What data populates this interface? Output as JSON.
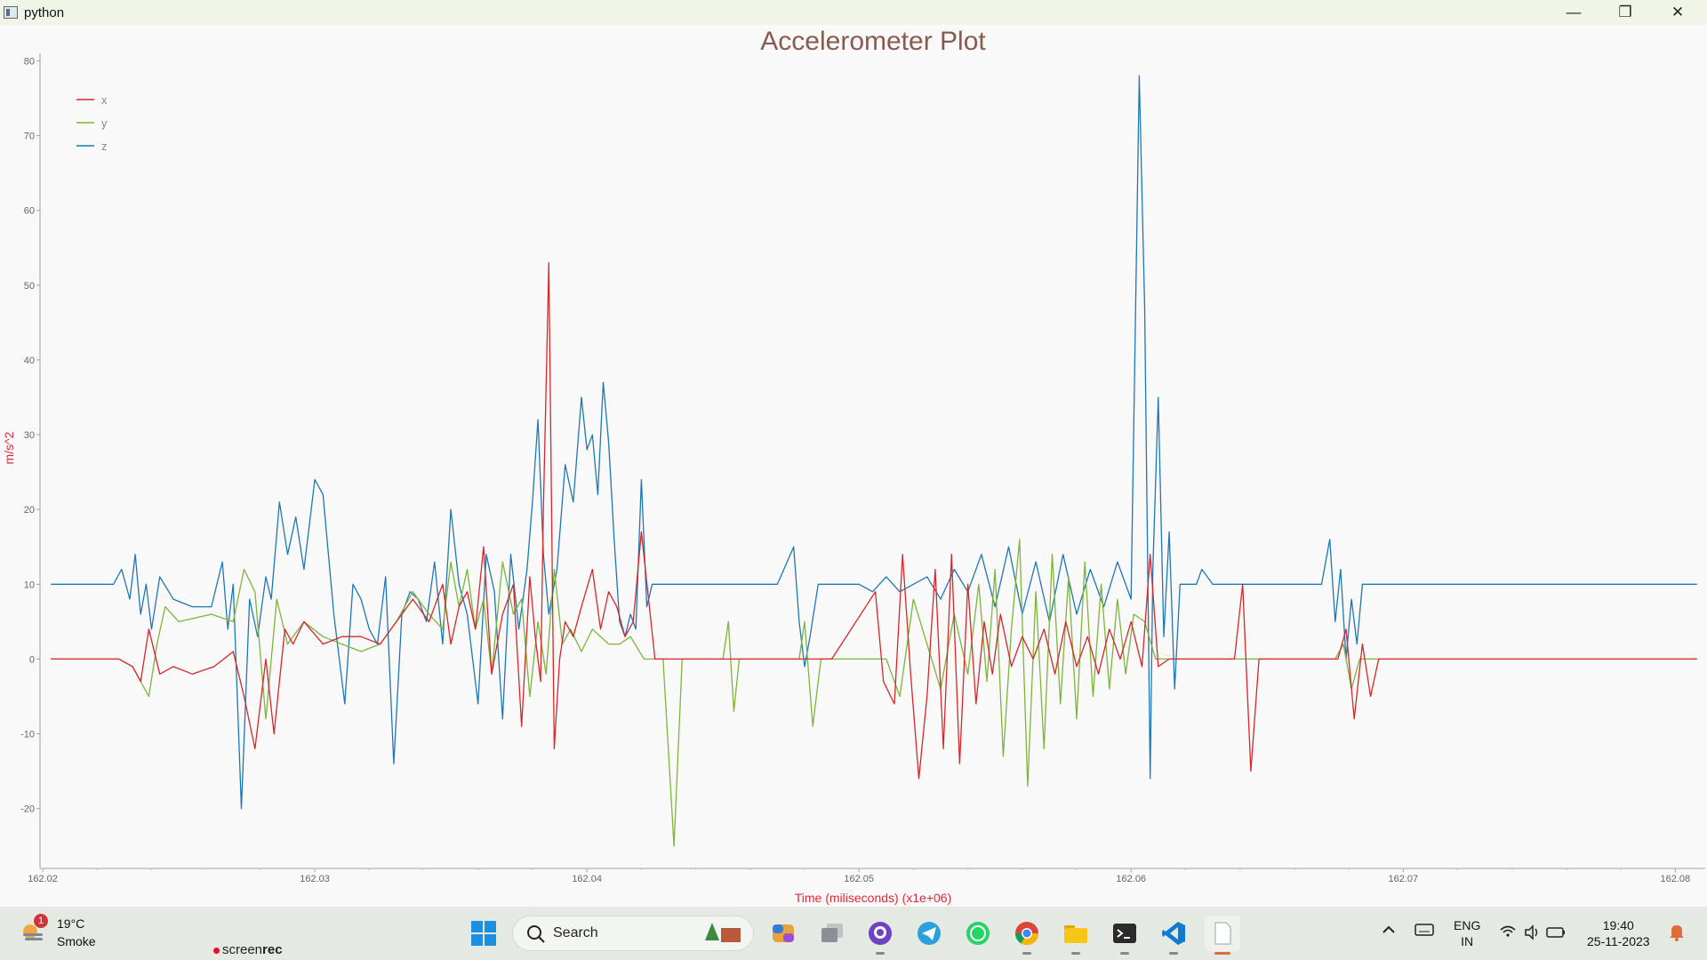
{
  "window": {
    "title": "python",
    "minimize_glyph": "—",
    "maximize_glyph": "❐",
    "close_glyph": "✕"
  },
  "chart_data": {
    "type": "line",
    "title": "Accelerometer Plot",
    "xlabel": "Time (miliseconds) (x1e+06)",
    "ylabel": "m/s^2",
    "xlim": [
      162.0199,
      162.0811
    ],
    "ylim": [
      -28,
      81
    ],
    "x_ticks": [
      "162.02",
      "162.03",
      "162.04",
      "162.05",
      "162.06",
      "162.07",
      "162.08"
    ],
    "x_tick_values": [
      162.02,
      162.03,
      162.04,
      162.05,
      162.06,
      162.07,
      162.08
    ],
    "y_ticks": [
      -20,
      -10,
      0,
      10,
      20,
      30,
      40,
      50,
      60,
      70,
      80
    ],
    "legend_position": "top-left",
    "grid": false,
    "series": [
      {
        "name": "x",
        "color": "#d62728",
        "x": [
          162.0203,
          162.0228,
          162.0233,
          162.0236,
          162.0239,
          162.0243,
          162.0248,
          162.0255,
          162.0263,
          162.027,
          162.0274,
          162.0278,
          162.0282,
          162.0285,
          162.0289,
          162.0292,
          162.0296,
          162.0303,
          162.031,
          162.0317,
          162.0324,
          162.033,
          162.0336,
          162.0342,
          162.0347,
          162.035,
          162.0353,
          162.0356,
          162.0359,
          162.0362,
          162.0365,
          162.0369,
          162.0373,
          162.0376,
          162.0379,
          162.0381,
          162.0383,
          162.0384,
          162.0386,
          162.0388,
          162.039,
          162.0392,
          162.0395,
          162.0398,
          162.0402,
          162.0405,
          162.0408,
          162.0411,
          162.0414,
          162.0417,
          162.042,
          162.0425,
          162.0428,
          162.0431,
          162.0433,
          162.0436,
          162.046,
          162.049,
          162.0506,
          162.0509,
          162.0513,
          162.0516,
          162.0519,
          162.0522,
          162.0525,
          162.0528,
          162.0531,
          162.0534,
          162.0537,
          162.054,
          162.0543,
          162.0546,
          162.0549,
          162.0552,
          162.0556,
          162.056,
          162.0564,
          162.0568,
          162.0572,
          162.0576,
          162.058,
          162.0584,
          162.0588,
          162.0592,
          162.0596,
          162.06,
          162.0604,
          162.0607,
          162.061,
          162.0614,
          162.0618,
          162.063,
          162.0638,
          162.0641,
          162.0644,
          162.0647,
          162.065,
          162.0665,
          162.0676,
          162.0679,
          162.0682,
          162.0685,
          162.0688,
          162.0691,
          162.0695,
          162.072,
          162.075,
          162.079,
          162.0808
        ],
        "y": [
          0,
          0,
          -1,
          -3,
          4,
          -2,
          -1,
          -2,
          -1,
          1,
          -5,
          -12,
          0,
          -10,
          4,
          2,
          5,
          2,
          3,
          3,
          2,
          5,
          8,
          5,
          10,
          2,
          7,
          9,
          4,
          15,
          -2,
          6,
          10,
          -9,
          11,
          3,
          -3,
          20,
          53,
          -12,
          0,
          5,
          3,
          7,
          12,
          4,
          9,
          7,
          3,
          5,
          17,
          0,
          0,
          0,
          0,
          0,
          0,
          0,
          9,
          -3,
          -6,
          14,
          -2,
          -16,
          -5,
          12,
          -12,
          14,
          -14,
          10,
          -6,
          5,
          -2,
          6,
          -1,
          3,
          0,
          4,
          -2,
          5,
          -1,
          3,
          -2,
          4,
          0,
          5,
          -1,
          14,
          -1,
          0,
          0,
          0,
          0,
          10,
          -15,
          0,
          0,
          0,
          0,
          4,
          -8,
          2,
          -5,
          0,
          0,
          0,
          0,
          0,
          0
        ]
      },
      {
        "name": "y",
        "color": "#7db43a",
        "x": [
          162.0203,
          162.0228,
          162.0233,
          162.0236,
          162.0239,
          162.0242,
          162.0245,
          162.025,
          162.0262,
          162.027,
          162.0274,
          162.0278,
          162.0282,
          162.0286,
          162.029,
          162.0296,
          162.0303,
          162.031,
          162.0317,
          162.0324,
          162.033,
          162.0336,
          162.0342,
          162.0347,
          162.035,
          162.0353,
          162.0356,
          162.0359,
          162.0362,
          162.0365,
          162.0369,
          162.0373,
          162.0376,
          162.0379,
          162.0382,
          162.0385,
          162.0388,
          162.0391,
          162.0394,
          162.0398,
          162.0402,
          162.0408,
          162.0412,
          162.0416,
          162.0421,
          162.0428,
          162.0432,
          162.0435,
          162.0438,
          162.044,
          162.045,
          162.0452,
          162.0454,
          162.0456,
          162.046,
          162.0478,
          162.048,
          162.0483,
          162.0486,
          162.049,
          162.051,
          162.0515,
          162.052,
          162.0525,
          162.053,
          162.0535,
          162.054,
          162.0544,
          162.0547,
          162.055,
          162.0553,
          162.0556,
          162.0559,
          162.0562,
          162.0565,
          162.0568,
          162.0571,
          162.0574,
          162.0577,
          162.058,
          162.0583,
          162.0586,
          162.0589,
          162.0592,
          162.0595,
          162.0598,
          162.0601,
          162.0605,
          162.0609,
          162.0613,
          162.0617,
          162.062,
          162.064,
          162.066,
          162.0675,
          162.0678,
          162.0681,
          162.0684,
          162.0688,
          162.072,
          162.078,
          162.0808
        ],
        "y": [
          0,
          0,
          -1,
          -3,
          -5,
          2,
          7,
          5,
          6,
          5,
          12,
          9,
          -8,
          8,
          2,
          5,
          3,
          2,
          1,
          2,
          5,
          9,
          6,
          4,
          13,
          7,
          12,
          4,
          8,
          -2,
          13,
          6,
          8,
          -5,
          5,
          -2,
          12,
          2,
          4,
          1,
          4,
          2,
          2,
          3,
          0,
          0,
          -25,
          0,
          0,
          0,
          0,
          5,
          -7,
          0,
          0,
          0,
          5,
          -9,
          0,
          0,
          0,
          -5,
          8,
          2,
          -4,
          6,
          -2,
          10,
          -3,
          12,
          -13,
          4,
          16,
          -17,
          9,
          -12,
          14,
          -6,
          11,
          -8,
          13,
          -5,
          10,
          -4,
          8,
          -2,
          6,
          5,
          0,
          0,
          0,
          0,
          0,
          0,
          0,
          2,
          -4,
          0,
          0,
          0,
          0,
          0
        ]
      },
      {
        "name": "z",
        "color": "#1f77b4",
        "x": [
          162.0203,
          162.0226,
          162.0229,
          162.0232,
          162.0234,
          162.0236,
          162.0238,
          162.024,
          162.0243,
          162.0248,
          162.0255,
          162.0262,
          162.0266,
          162.0268,
          162.027,
          162.0273,
          162.0276,
          162.0279,
          162.0282,
          162.0284,
          162.0287,
          162.029,
          162.0293,
          162.0296,
          162.03,
          162.0303,
          162.0307,
          162.0311,
          162.0314,
          162.0317,
          162.032,
          162.0323,
          162.0326,
          162.0329,
          162.0332,
          162.0335,
          162.0338,
          162.0341,
          162.0344,
          162.0347,
          162.035,
          162.0353,
          162.0356,
          162.036,
          162.0363,
          162.0366,
          162.0369,
          162.0372,
          162.0375,
          162.0378,
          162.038,
          162.0382,
          162.0384,
          162.0386,
          162.0389,
          162.0392,
          162.0395,
          162.0398,
          162.04,
          162.0402,
          162.0404,
          162.0406,
          162.0408,
          162.041,
          162.0412,
          162.0414,
          162.0416,
          162.0418,
          162.042,
          162.0422,
          162.0424,
          162.0427,
          162.043,
          162.0432,
          162.0434,
          162.0436,
          162.047,
          162.0476,
          162.0478,
          162.048,
          162.0482,
          162.0485,
          162.0488,
          162.049,
          162.05,
          162.0505,
          162.051,
          162.0515,
          162.052,
          162.0525,
          162.053,
          162.0535,
          162.054,
          162.0545,
          162.055,
          162.0555,
          162.056,
          162.0565,
          162.057,
          162.0575,
          162.058,
          162.0585,
          162.059,
          162.0595,
          162.06,
          162.0603,
          162.0605,
          162.0607,
          162.0608,
          162.061,
          162.0612,
          162.0614,
          162.0616,
          162.0618,
          162.062,
          162.0622,
          162.0624,
          162.0626,
          162.063,
          162.064,
          162.0642,
          162.0645,
          162.066,
          162.067,
          162.0673,
          162.0675,
          162.0677,
          162.0679,
          162.0681,
          162.0683,
          162.0685,
          162.0688,
          162.075,
          162.0808
        ],
        "y": [
          10,
          10,
          12,
          8,
          14,
          6,
          10,
          4,
          11,
          8,
          7,
          7,
          13,
          4,
          10,
          -20,
          8,
          3,
          11,
          8,
          21,
          14,
          19,
          12,
          24,
          22,
          6,
          -6,
          10,
          8,
          4,
          2,
          11,
          -14,
          6,
          9,
          8,
          5,
          13,
          2,
          20,
          10,
          6,
          -6,
          14,
          9,
          -8,
          14,
          4,
          12,
          21,
          32,
          14,
          6,
          12,
          26,
          21,
          35,
          28,
          30,
          22,
          37,
          29,
          16,
          5,
          3,
          6,
          4,
          24,
          7,
          10,
          10,
          10,
          10,
          10,
          10,
          10,
          15,
          5,
          -1,
          3,
          10,
          10,
          10,
          10,
          9,
          11,
          9,
          10,
          11,
          8,
          12,
          9,
          14,
          7,
          15,
          6,
          13,
          5,
          14,
          6,
          12,
          7,
          13,
          8,
          78,
          47,
          -16,
          12,
          35,
          3,
          17,
          -4,
          10,
          10,
          10,
          10,
          12,
          10,
          10,
          10,
          10,
          10,
          10,
          16,
          5,
          12,
          0,
          8,
          2,
          10,
          10,
          10,
          10
        ]
      }
    ]
  },
  "taskbar": {
    "weather": {
      "temp": "19°C",
      "condition": "Smoke",
      "badge": "1"
    },
    "recorder": {
      "prefix": "screen",
      "suffix": "rec"
    },
    "search_label": "Search",
    "apps": [
      "windows-start",
      "search",
      "copilot",
      "task-view",
      "github-desktop",
      "telegram",
      "whatsapp",
      "chrome",
      "file-explorer",
      "terminal",
      "vs-code",
      "notepad"
    ],
    "lang_top": "ENG",
    "lang_bottom": "IN",
    "time": "19:40",
    "date": "25-11-2023"
  }
}
